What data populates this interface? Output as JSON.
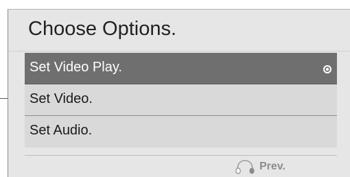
{
  "screen": {
    "title": "Choose Options."
  },
  "menu": {
    "items": [
      {
        "label": "Set Video Play.",
        "selected": true
      },
      {
        "label": "Set Video.",
        "selected": false
      },
      {
        "label": "Set Audio.",
        "selected": false
      }
    ],
    "selection_indicator_icon": "radio-selected-icon"
  },
  "footer": {
    "prev_label": "Prev.",
    "prev_icon": "headset-controller-icon"
  },
  "colors": {
    "panel_background": "#e6e6e6",
    "item_background": "#d9d9d9",
    "selected_item_background": "#6f6f6f",
    "selected_item_text": "#ffffff",
    "footer_text": "#8c8c8c"
  }
}
